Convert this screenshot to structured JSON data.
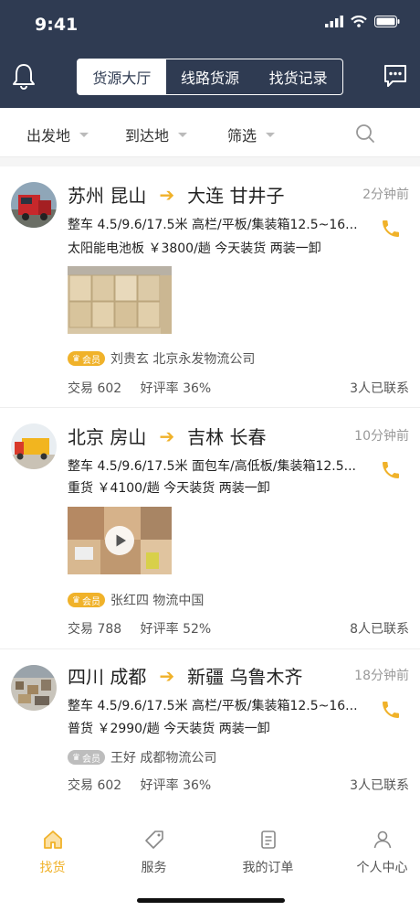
{
  "status": {
    "time": "9:41"
  },
  "header": {
    "tabs": [
      "货源大厅",
      "线路货源",
      "找货记录"
    ],
    "active_tab": 0
  },
  "filter": {
    "origin": "出发地",
    "destination": "到达地",
    "filter": "筛选"
  },
  "cards": [
    {
      "from": "苏州 昆山",
      "to": "大连 甘井子",
      "ago": "2分钟前",
      "spec": "整车 4.5/9.6/17.5米 高栏/平板/集装箱12.5~16...",
      "cargo": "太阳能电池板 ￥3800/趟 今天装货 两装一卸",
      "member": "会员",
      "owner": "刘贵玄 北京永发物流公司",
      "trades": "交易 602",
      "rating": "好评率 36%",
      "contacted": "3人已联系"
    },
    {
      "from": "北京 房山",
      "to": "吉林 长春",
      "ago": "10分钟前",
      "spec": "整车 4.5/9.6/17.5米 面包车/高低板/集装箱12.5...",
      "cargo": "重货 ￥4100/趟 今天装货 两装一卸",
      "member": "会员",
      "owner": "张红四 物流中国",
      "trades": "交易 788",
      "rating": "好评率 52%",
      "contacted": "8人已联系"
    },
    {
      "from": "四川 成都",
      "to": "新疆 乌鲁木齐",
      "ago": "18分钟前",
      "spec": "整车 4.5/9.6/17.5米 高栏/平板/集装箱12.5~16...",
      "cargo": "普货 ￥2990/趟 今天装货 两装一卸",
      "member": "会员",
      "owner": "王好 成都物流公司",
      "trades": "交易 602",
      "rating": "好评率 36%",
      "contacted": "3人已联系"
    }
  ],
  "tabbar": [
    {
      "label": "找货",
      "icon": "home-icon"
    },
    {
      "label": "服务",
      "icon": "tag-icon"
    },
    {
      "label": "我的订单",
      "icon": "order-icon"
    },
    {
      "label": "个人中心",
      "icon": "user-icon"
    }
  ],
  "colors": {
    "header_bg": "#2f3b52",
    "accent": "#f0b22a"
  }
}
